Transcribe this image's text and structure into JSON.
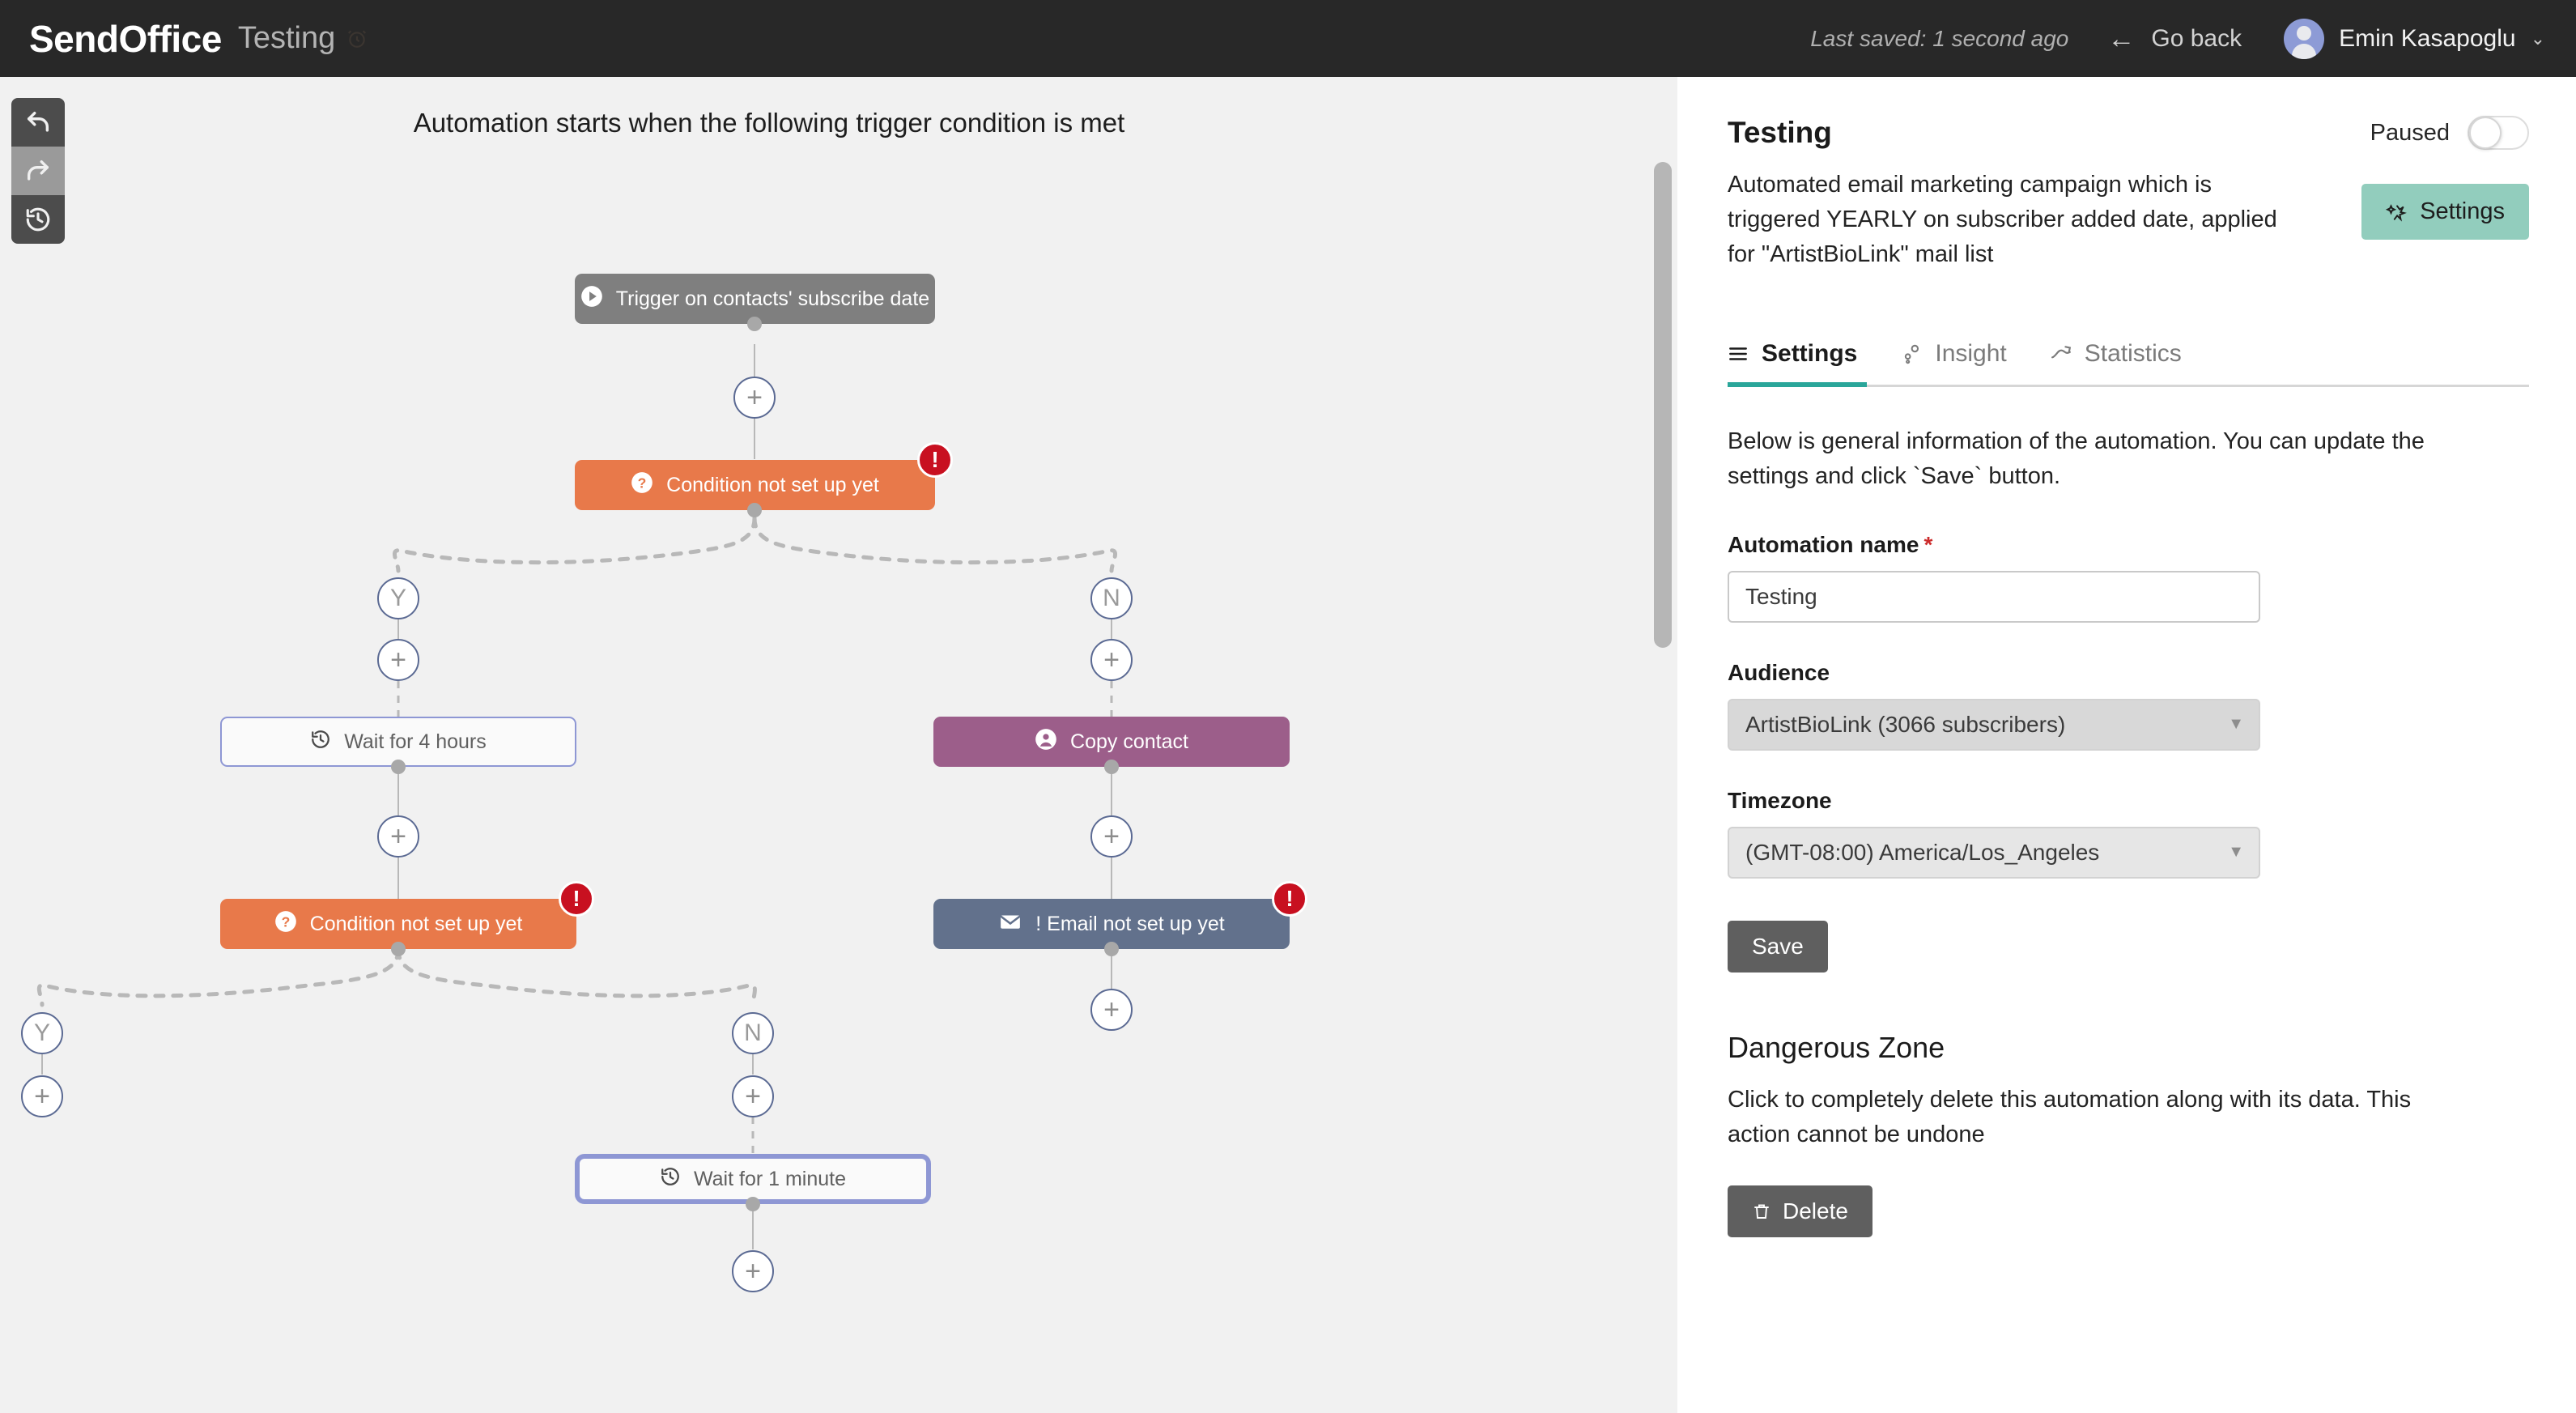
{
  "topbar": {
    "brand": "SendOffice",
    "doc_title": "Testing",
    "alarm_icon": "alarm-clock-icon",
    "last_saved": "Last saved: 1 second ago",
    "go_back": "Go back",
    "back_arrow": "←",
    "username": "Emin Kasapoglu",
    "caret": "⌄"
  },
  "toolbar": {
    "undo": "undo-icon",
    "redo": "redo-icon",
    "history": "history-icon"
  },
  "canvas": {
    "title": "Automation starts when the following trigger condition is met",
    "nodes": [
      {
        "id": "trigger",
        "label": "Trigger on contacts' subscribe date",
        "icon": "play-icon",
        "type": "trigger"
      },
      {
        "id": "cond1",
        "label": "Condition not set up yet",
        "icon": "question-icon",
        "type": "cond",
        "error": "!"
      },
      {
        "id": "branch1y",
        "label": "Y"
      },
      {
        "id": "branch1n",
        "label": "N"
      },
      {
        "id": "wait4h",
        "label": "Wait for 4 hours",
        "icon": "history-icon",
        "type": "wait"
      },
      {
        "id": "copy",
        "label": "Copy contact",
        "icon": "user-icon",
        "type": "copy"
      },
      {
        "id": "cond2",
        "label": "Condition not set up yet",
        "icon": "question-icon",
        "type": "cond",
        "error": "!"
      },
      {
        "id": "email",
        "label": "! Email not set up yet",
        "icon": "envelope-icon",
        "type": "email",
        "error": "!"
      },
      {
        "id": "branch2y",
        "label": "Y"
      },
      {
        "id": "branch2n",
        "label": "N"
      },
      {
        "id": "wait1m",
        "label": "Wait for 1 minute",
        "icon": "history-icon",
        "type": "wait",
        "selected": true
      }
    ],
    "add_label": "+"
  },
  "panel": {
    "title": "Testing",
    "description": "Automated email marketing campaign which is triggered YEARLY on subscriber added date, applied for \"ArtistBioLink\" mail list",
    "pause_label": "Paused",
    "pause_on": false,
    "settings_button": "Settings",
    "settings_icon": "sparkle-icon",
    "tabs": [
      {
        "label": "Settings",
        "icon": "menu-icon",
        "active": true
      },
      {
        "label": "Insight",
        "icon": "insight-icon",
        "active": false
      },
      {
        "label": "Statistics",
        "icon": "chart-icon",
        "active": false
      }
    ],
    "help_text": "Below is general information of the automation. You can update the settings and click `Save` button.",
    "fields": {
      "automation_name_label": "Automation name",
      "required_mark": "*",
      "automation_name_value": "Testing",
      "automation_name_placeholder": "Automation name",
      "audience_label": "Audience",
      "audience_value": "ArtistBioLink (3066 subscribers)",
      "timezone_label": "Timezone",
      "timezone_value": "(GMT-08:00) America/Los_Angeles",
      "select_arrow": "▼"
    },
    "save_button": "Save",
    "danger_title": "Dangerous Zone",
    "danger_text": "Click to completely delete this automation along with its data. This action cannot be undone",
    "delete_button": "Delete",
    "delete_icon": "trash-icon"
  },
  "colors": {
    "topbar_bg": "#282828",
    "canvas_bg": "#f1f1f1",
    "trigger": "#7f7f7f",
    "condition": "#e8794a",
    "copy_contact": "#9c5e8a",
    "email": "#62718c",
    "wait_border": "#8e97d4",
    "error_badge": "#c81020",
    "tab_accent": "#2aa69a",
    "settings_btn": "#92cdbd",
    "required": "#cc2c2c"
  }
}
